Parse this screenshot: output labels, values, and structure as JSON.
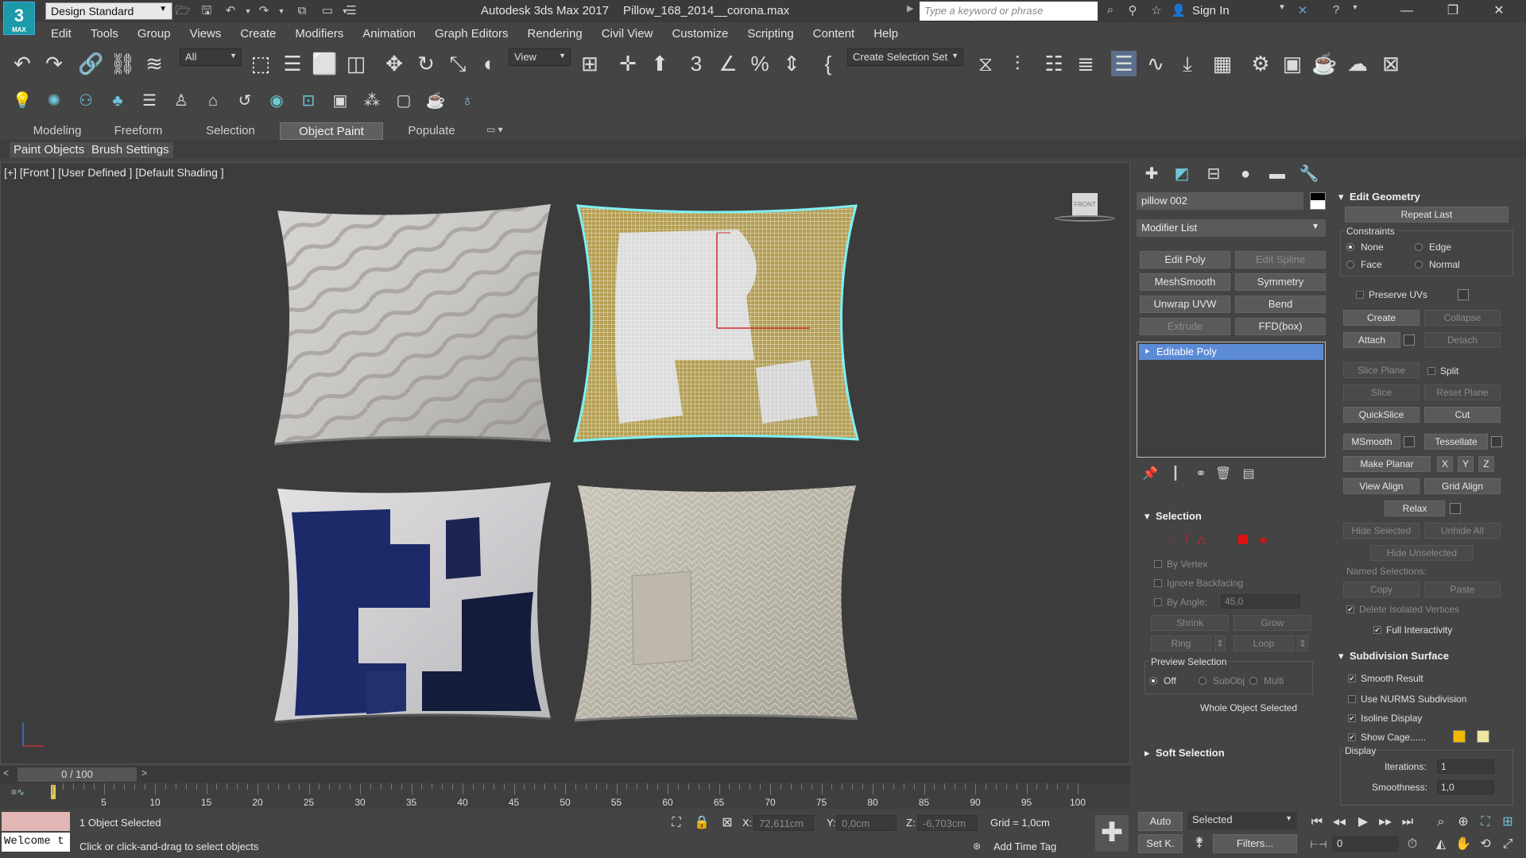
{
  "titlebar": {
    "workspace": "Design Standard",
    "app_title": "Autodesk 3ds Max 2017",
    "file_title": "Pillow_168_2014__corona.max",
    "search_placeholder": "Type a keyword or phrase",
    "sign_in": "Sign In",
    "logo_text": "3",
    "logo_sub": "MAX"
  },
  "menu": [
    "Edit",
    "Tools",
    "Group",
    "Views",
    "Create",
    "Modifiers",
    "Animation",
    "Graph Editors",
    "Rendering",
    "Civil View",
    "Customize",
    "Scripting",
    "Content",
    "Help"
  ],
  "toolbar": {
    "selection_filter": "All",
    "ref_coord": "View",
    "named_selection": "Create Selection Set"
  },
  "ribbon": {
    "tabs": [
      "Modeling",
      "Freeform",
      "Selection",
      "Object Paint",
      "Populate"
    ],
    "active_tab": "Object Paint",
    "sub_buttons": [
      "Paint Objects",
      "Brush Settings"
    ]
  },
  "viewport": {
    "label": "[+] [Front ] [User Defined ] [Default Shading ]",
    "viewcube_label": "FRONT"
  },
  "timeline": {
    "frame": "0 / 100",
    "ticks": [
      "5",
      "10",
      "15",
      "20",
      "25",
      "30",
      "35",
      "40",
      "45",
      "50",
      "55",
      "60",
      "65",
      "70",
      "75",
      "80",
      "85",
      "90",
      "95",
      "100"
    ]
  },
  "status": {
    "selected": "1 Object Selected",
    "prompt": "Click or click-and-drag to select objects",
    "welcome": "Welcome t",
    "x_label": "X:",
    "x_value": "72,611cm",
    "y_label": "Y:",
    "y_value": "0,0cm",
    "z_label": "Z:",
    "z_value": "-6,703cm",
    "grid": "Grid = 1,0cm",
    "add_time_tag": "Add Time Tag",
    "auto": "Auto",
    "set_key": "Set K.",
    "key_mode": "Selected",
    "filters": "Filters...",
    "frame_field": "0"
  },
  "command_panel": {
    "object_name": "pillow 002",
    "modifier_list": "Modifier List",
    "modifier_buttons": [
      {
        "label": "Edit Poly",
        "enabled": true
      },
      {
        "label": "Edit Spline",
        "enabled": false
      },
      {
        "label": "MeshSmooth",
        "enabled": true
      },
      {
        "label": "Symmetry",
        "enabled": true
      },
      {
        "label": "Unwrap UVW",
        "enabled": true
      },
      {
        "label": "Bend",
        "enabled": true
      },
      {
        "label": "Extrude",
        "enabled": false
      },
      {
        "label": "FFD(box)",
        "enabled": true
      }
    ],
    "stack_item": "Editable Poly",
    "selection": {
      "title": "Selection",
      "by_vertex": "By Vertex",
      "ignore_backfacing": "Ignore Backfacing",
      "by_angle": "By Angle:",
      "angle_value": "45,0",
      "shrink": "Shrink",
      "grow": "Grow",
      "ring": "Ring",
      "loop": "Loop",
      "preview_selection": "Preview Selection",
      "preview_off": "Off",
      "preview_subobj": "SubObj",
      "preview_multi": "Multi",
      "whole_object": "Whole Object Selected"
    },
    "soft_selection": "Soft Selection",
    "edit_geometry": {
      "title": "Edit Geometry",
      "repeat_last": "Repeat Last",
      "constraints": "Constraints",
      "none": "None",
      "edge": "Edge",
      "face": "Face",
      "normal": "Normal",
      "preserve_uvs": "Preserve UVs",
      "create": "Create",
      "collapse": "Collapse",
      "attach": "Attach",
      "detach": "Detach",
      "slice_plane": "Slice Plane",
      "split": "Split",
      "slice": "Slice",
      "reset_plane": "Reset Plane",
      "quickslice": "QuickSlice",
      "cut": "Cut",
      "msmooth": "MSmooth",
      "tessellate": "Tessellate",
      "make_planar": "Make Planar",
      "x": "X",
      "y": "Y",
      "z": "Z",
      "view_align": "View Align",
      "grid_align": "Grid Align",
      "relax": "Relax",
      "hide_selected": "Hide Selected",
      "unhide_all": "Unhide All",
      "hide_unselected": "Hide Unselected",
      "named_selections": "Named Selections:",
      "copy": "Copy",
      "paste": "Paste",
      "delete_isolated": "Delete Isolated Vertices",
      "full_interactivity": "Full Interactivity"
    },
    "subdivision": {
      "title": "Subdivision Surface",
      "smooth_result": "Smooth Result",
      "use_nurms": "Use NURMS Subdivision",
      "isoline": "Isoline Display",
      "show_cage": "Show Cage......",
      "display": "Display",
      "iterations_label": "Iterations:",
      "iterations": "1",
      "smoothness_label": "Smoothness:",
      "smoothness": "1,0",
      "cage_color_1": "#f2b800",
      "cage_color_2": "#efe6a0"
    }
  },
  "colors": {
    "accent": "#5b8bd6",
    "selection_cyan": "#7ff0f5"
  }
}
